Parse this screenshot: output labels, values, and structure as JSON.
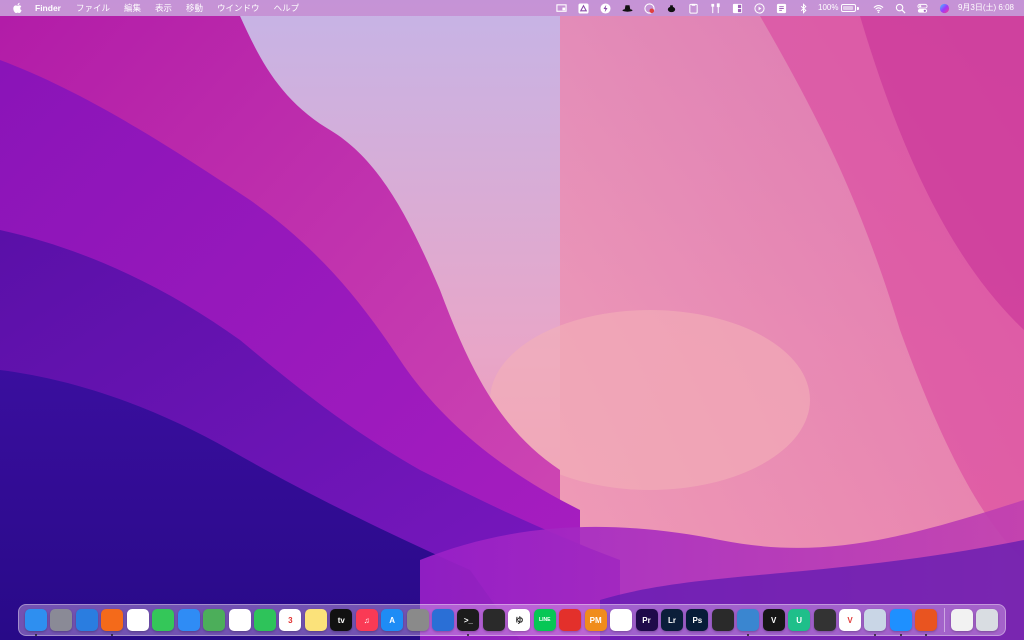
{
  "colors": {
    "wallpaper_top": "#c8a8e8",
    "wallpaper_left": "#8a14b8",
    "wallpaper_bottom": "#3a0a9a",
    "wallpaper_right": "#e060a0",
    "menubar_bg": "#c478c8"
  },
  "menubar": {
    "apple_icon": "apple-icon",
    "app_name": "Finder",
    "menus": [
      "ファイル",
      "編集",
      "表示",
      "移動",
      "ウインドウ",
      "ヘルプ"
    ],
    "status_icons": [
      "screen-mirror-icon",
      "google-drive-icon",
      "bolt-icon",
      "hat-icon",
      "cloud-app-icon",
      "teapot-icon",
      "clipboard-icon",
      "tools-icon",
      "window-layout-icon",
      "play-circle-icon",
      "script-icon",
      "bluetooth-icon"
    ],
    "battery_percent": "100%",
    "battery_icon": "battery-icon",
    "right_icons": [
      "wifi-icon",
      "spotlight-search-icon",
      "control-center-icon",
      "siri-icon"
    ],
    "clock": "9月3日(土)  6:08"
  },
  "dock": {
    "apps": [
      {
        "name": "finder",
        "icon": "finder-icon",
        "label": "",
        "color": "#2e8ff0",
        "running": true
      },
      {
        "name": "launchpad",
        "icon": "launchpad-icon",
        "label": "",
        "color": "#8a8a96",
        "running": false
      },
      {
        "name": "safari",
        "icon": "safari-icon",
        "label": "",
        "color": "#2a7de0",
        "running": false
      },
      {
        "name": "firefox",
        "icon": "firefox-icon",
        "label": "",
        "color": "#f46a1a",
        "running": true
      },
      {
        "name": "chrome",
        "icon": "chrome-icon",
        "label": "",
        "color": "#ffffff",
        "running": false
      },
      {
        "name": "messages",
        "icon": "messages-icon",
        "label": "",
        "color": "#34c759",
        "running": false
      },
      {
        "name": "mail",
        "icon": "mail-icon",
        "label": "",
        "color": "#2f8cf5",
        "running": false
      },
      {
        "name": "maps",
        "icon": "maps-icon",
        "label": "",
        "color": "#4cae5a",
        "running": false
      },
      {
        "name": "photos",
        "icon": "photos-icon",
        "label": "",
        "color": "#ffffff",
        "running": false
      },
      {
        "name": "facetime",
        "icon": "facetime-icon",
        "label": "",
        "color": "#2ec35a",
        "running": false
      },
      {
        "name": "calendar",
        "icon": "calendar-icon",
        "label": "3",
        "color": "#ffffff",
        "running": false
      },
      {
        "name": "notes",
        "icon": "notes-icon",
        "label": "",
        "color": "#fbe27a",
        "running": false
      },
      {
        "name": "apple-tv",
        "icon": "apple-tv-icon",
        "label": "tv",
        "color": "#111111",
        "running": false
      },
      {
        "name": "music",
        "icon": "music-icon",
        "label": "♫",
        "color": "#fa3a55",
        "running": false
      },
      {
        "name": "app-store",
        "icon": "app-store-icon",
        "label": "A",
        "color": "#1e8cf5",
        "running": false
      },
      {
        "name": "system-preferences",
        "icon": "gear-icon",
        "label": "",
        "color": "#8a8a8a",
        "running": false
      },
      {
        "name": "xcode",
        "icon": "xcode-icon",
        "label": "",
        "color": "#2a6fd6",
        "running": false
      },
      {
        "name": "terminal",
        "icon": "terminal-icon",
        "label": ">_",
        "color": "#1c1c1c",
        "running": true
      },
      {
        "name": "calligraphy-app",
        "icon": "calligraphy-icon",
        "label": "",
        "color": "#2a2a2a",
        "running": false
      },
      {
        "name": "yukkuri-app",
        "icon": "yukkuri-icon",
        "label": "ゆ",
        "color": "#ffffff",
        "running": false
      },
      {
        "name": "line",
        "icon": "line-icon",
        "label": "LINE",
        "color": "#06c755",
        "running": false
      },
      {
        "name": "creative-cloud",
        "icon": "creative-cloud-icon",
        "label": "",
        "color": "#e3302b",
        "running": false
      },
      {
        "name": "pm-app",
        "icon": "pm-icon",
        "label": "PM",
        "color": "#f08c1c",
        "running": false
      },
      {
        "name": "recorder",
        "icon": "record-icon",
        "label": "",
        "color": "#ffffff",
        "running": false
      },
      {
        "name": "premiere-pro",
        "icon": "premiere-icon",
        "label": "Pr",
        "color": "#1f0a4a",
        "running": false
      },
      {
        "name": "lightroom",
        "icon": "lightroom-icon",
        "label": "Lr",
        "color": "#0b1e3a",
        "running": false
      },
      {
        "name": "photoshop",
        "icon": "photoshop-icon",
        "label": "Ps",
        "color": "#071c38",
        "running": false
      },
      {
        "name": "obs",
        "icon": "obs-icon",
        "label": "",
        "color": "#2a2a2a",
        "running": false
      },
      {
        "name": "screen-app",
        "icon": "screen-icon",
        "label": "",
        "color": "#3a86d0",
        "running": true
      },
      {
        "name": "vectorworks",
        "icon": "v-icon",
        "label": "V",
        "color": "#161616",
        "running": false
      },
      {
        "name": "u-app",
        "icon": "u-icon",
        "label": "U",
        "color": "#1fbf8a",
        "running": false
      },
      {
        "name": "brush-app",
        "icon": "brush-icon",
        "label": "",
        "color": "#333333",
        "running": false
      },
      {
        "name": "vivaldi",
        "icon": "vivaldi-icon",
        "label": "V",
        "color": "#ffffff",
        "running": false
      },
      {
        "name": "preview",
        "icon": "preview-icon",
        "label": "",
        "color": "#c9d6e6",
        "running": true
      },
      {
        "name": "windows-app",
        "icon": "windows-icon",
        "label": "",
        "color": "#1e90ff",
        "running": true
      },
      {
        "name": "ubuntu",
        "icon": "ubuntu-icon",
        "label": "",
        "color": "#e95420",
        "running": true
      }
    ],
    "trailing": [
      {
        "name": "java",
        "icon": "java-icon",
        "label": "",
        "color": "#f2f2f2"
      },
      {
        "name": "trash",
        "icon": "trash-icon",
        "label": "",
        "color": "#d9dde2"
      }
    ]
  }
}
